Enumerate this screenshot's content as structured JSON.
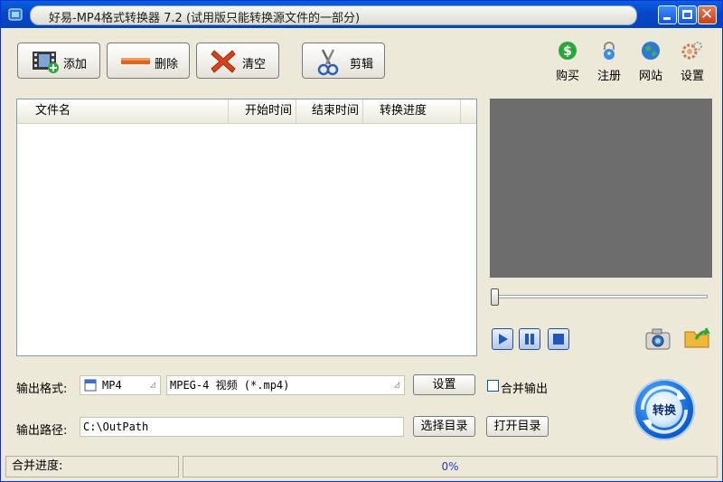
{
  "window": {
    "title": "好易-MP4格式转换器 7.2 (试用版只能转换源文件的一部分)"
  },
  "toolbar": {
    "add_label": "添加",
    "delete_label": "删除",
    "clear_label": "清空",
    "cut_label": "剪辑",
    "buy_label": "购买",
    "register_label": "注册",
    "website_label": "网站",
    "settings_label": "设置"
  },
  "file_list": {
    "columns": [
      "文件名",
      "开始时间",
      "结束时间",
      "转换进度"
    ],
    "rows": []
  },
  "output": {
    "format_label": "输出格式:",
    "format_value": "MP4",
    "format_desc": "MPEG-4 视频 (*.mp4)",
    "settings_label": "设置",
    "merge_label": "合并输出",
    "path_label": "输出路径:",
    "path_value": "C:\\OutPath",
    "choose_dir_label": "选择目录",
    "open_dir_label": "打开目录"
  },
  "convert": {
    "label": "转换"
  },
  "status": {
    "merge_progress_label": "合并进度:",
    "progress_text": "0%",
    "progress_fraction": 0
  },
  "colors": {
    "title_bar": "#0546c9",
    "preview_bg": "#6d6d6d",
    "window_bg": "#ece9d8",
    "accent_red": "#e04a1a",
    "accent_blue": "#1064d6"
  }
}
